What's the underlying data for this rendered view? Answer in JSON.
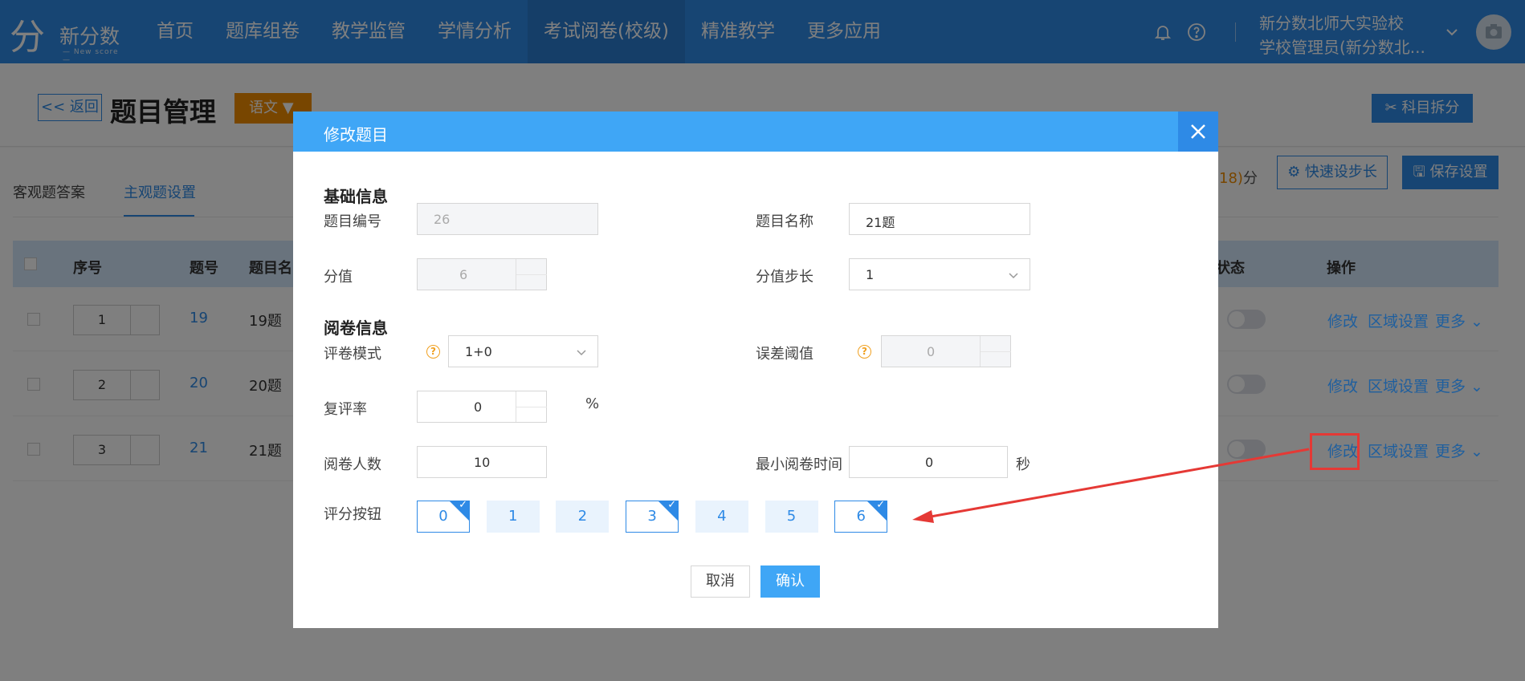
{
  "nav": {
    "logo_name": "新分数",
    "logo_sub": "— New score —",
    "items": [
      "首页",
      "题库组卷",
      "教学监管",
      "学情分析",
      "考试阅卷(校级)",
      "精准教学",
      "更多应用"
    ],
    "school_name": "新分数北师大实验校",
    "user_role": "学校管理员(新分数北..."
  },
  "page": {
    "back_label": "<< 返回",
    "title": "题目管理",
    "subject": "语文 ▼",
    "split_label": "✂ 科目拆分",
    "tab_objective": "客观题答案",
    "tab_subjective": "主观题设置",
    "score_num": "18)",
    "score_unit": "分",
    "quick_step_label": "⚙ 快速设步长",
    "save_label": "🖫 保存设置",
    "columns": {
      "seq": "序号",
      "no": "题号",
      "name": "题目名",
      "status": "状态",
      "ops": "操作"
    },
    "rows": [
      {
        "seq": "1",
        "no": "19",
        "name": "19题"
      },
      {
        "seq": "2",
        "no": "20",
        "name": "20题"
      },
      {
        "seq": "3",
        "no": "21",
        "name": "21题"
      }
    ],
    "op_edit": "修改",
    "op_area": "区域设置",
    "op_more": "更多 ⌄"
  },
  "modal": {
    "title": "修改题目",
    "section_basic": "基础信息",
    "label_no": "题目编号",
    "value_no": "26",
    "label_name": "题目名称",
    "value_name": "21题",
    "label_score": "分值",
    "value_score": "6",
    "label_step": "分值步长",
    "value_step": "1",
    "section_review": "阅卷信息",
    "label_mode": "评卷模式",
    "value_mode": "1+0",
    "label_threshold": "误差阈值",
    "value_threshold": "0",
    "label_recheck": "复评率",
    "value_recheck": "0",
    "unit_percent": "%",
    "label_readers": "阅卷人数",
    "value_readers": "10",
    "label_min_time": "最小阅卷时间",
    "value_min_time": "0",
    "unit_seconds": "秒",
    "label_score_buttons": "评分按钮",
    "score_buttons": [
      {
        "label": "0",
        "selected": true
      },
      {
        "label": "1",
        "selected": false
      },
      {
        "label": "2",
        "selected": false
      },
      {
        "label": "3",
        "selected": true
      },
      {
        "label": "4",
        "selected": false
      },
      {
        "label": "5",
        "selected": false
      },
      {
        "label": "6",
        "selected": true
      }
    ],
    "cancel_label": "取消",
    "confirm_label": "确认"
  },
  "colors": {
    "primary": "#2e8ae6",
    "modal_header": "#3fa6f6",
    "accent_orange": "#f08c00",
    "annotation_red": "#e53935"
  }
}
